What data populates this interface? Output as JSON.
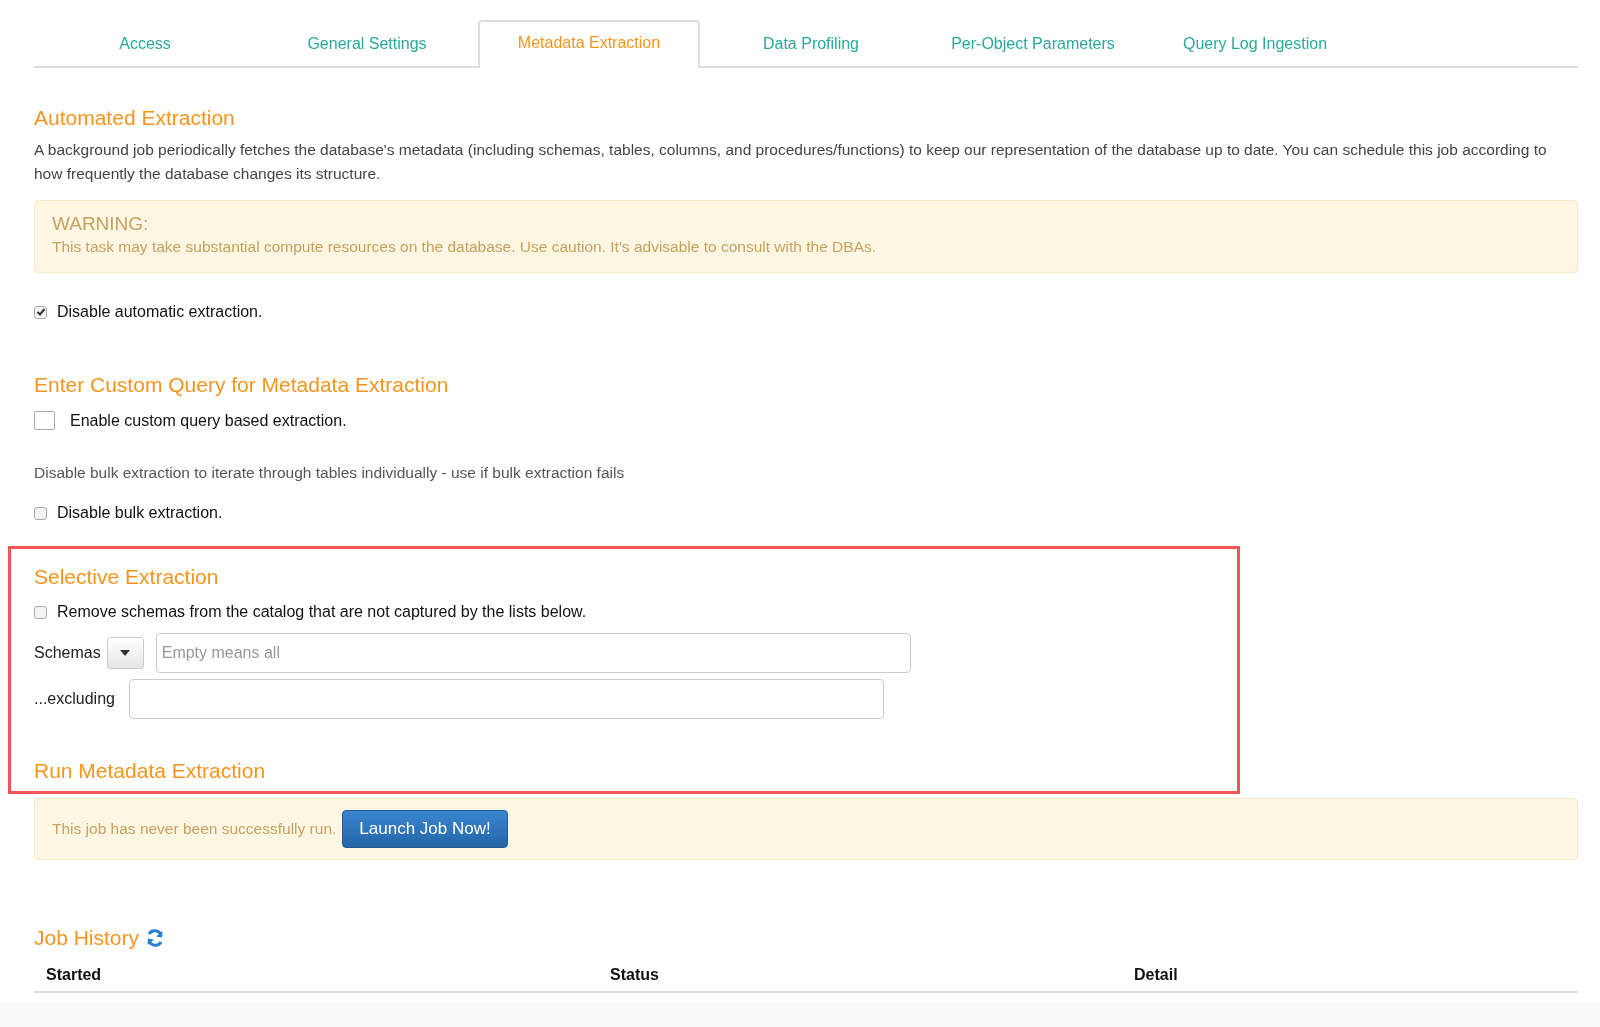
{
  "tabs": [
    {
      "label": "Access",
      "selected": false
    },
    {
      "label": "General Settings",
      "selected": false
    },
    {
      "label": "Metadata Extraction",
      "selected": true
    },
    {
      "label": "Data Profiling",
      "selected": false
    },
    {
      "label": "Per-Object Parameters",
      "selected": false
    },
    {
      "label": "Query Log Ingestion",
      "selected": false
    }
  ],
  "automated": {
    "heading": "Automated Extraction",
    "description": "A background job periodically fetches the database's metadata (including schemas, tables, columns, and procedures/functions) to keep our representation of the database up to date. You can schedule this job according to how frequently the database changes its structure.",
    "warning": {
      "title": "WARNING:",
      "text": "This task may take substantial compute resources on the database. Use caution. It's advisable to consult with the DBAs."
    },
    "checkbox": {
      "label": "Disable automatic extraction.",
      "checked": true
    }
  },
  "custom_query": {
    "heading": "Enter Custom Query for Metadata Extraction",
    "checkbox": {
      "label": "Enable custom query based extraction.",
      "checked": false
    },
    "note": "Disable bulk extraction to iterate through tables individually - use if bulk extraction fails",
    "bulk_checkbox": {
      "label": "Disable bulk extraction.",
      "checked": false
    }
  },
  "selective": {
    "heading": "Selective Extraction",
    "checkbox": {
      "label": "Remove schemas from the catalog that are not captured by the lists below.",
      "checked": false
    },
    "schemas_label": "Schemas",
    "schemas_placeholder": "Empty means all",
    "excluding_label": "...excluding"
  },
  "run": {
    "heading": "Run Metadata Extraction",
    "status": "This job has never been successfully run.",
    "button": "Launch Job Now!"
  },
  "job_history": {
    "heading": "Job History",
    "columns": [
      "Started",
      "Status",
      "Detail"
    ]
  }
}
